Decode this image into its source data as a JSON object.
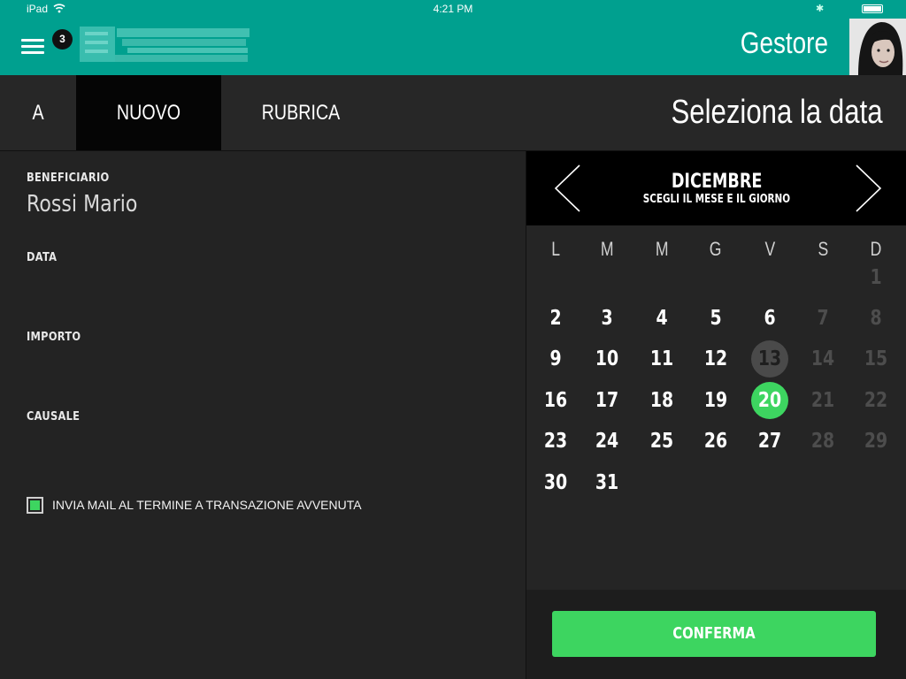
{
  "status_bar": {
    "carrier": "iPad",
    "time": "4:21 PM"
  },
  "header": {
    "menu_badge": "3",
    "manager_label": "Gestore",
    "accent_color": "#00a08f",
    "icons": [
      "menu-icon",
      "wifi-icon",
      "bluetooth-icon",
      "battery-icon"
    ]
  },
  "tabs": {
    "items": [
      {
        "label": "A"
      },
      {
        "label": "NUOVO",
        "active": true
      },
      {
        "label": "RUBRICA"
      }
    ],
    "section_title": "Seleziona la data"
  },
  "form": {
    "beneficiary_label": "BENEFICIARIO",
    "beneficiary_value": "Rossi Mario",
    "date_label": "DATA",
    "amount_label": "IMPORTO",
    "reason_label": "CAUSALE",
    "send_mail_label": "INVIA MAIL AL TERMINE A TRANSAZIONE AVVENUTA",
    "send_mail_checked": true,
    "check_color": "#3dd560"
  },
  "calendar": {
    "month": "DICEMBRE",
    "subtitle": "SCEGLI IL MESE E IL GIORNO",
    "weekdays": [
      "L",
      "M",
      "M",
      "G",
      "V",
      "S",
      "D"
    ],
    "weeks": [
      [
        "",
        "",
        "",
        "",
        "",
        "",
        "1"
      ],
      [
        "2",
        "3",
        "4",
        "5",
        "6",
        "7",
        "8"
      ],
      [
        "9",
        "10",
        "11",
        "12",
        "13",
        "14",
        "15"
      ],
      [
        "16",
        "17",
        "18",
        "19",
        "20",
        "21",
        "22"
      ],
      [
        "23",
        "24",
        "25",
        "26",
        "27",
        "28",
        "29"
      ],
      [
        "30",
        "31",
        "",
        "",
        "",
        "",
        ""
      ]
    ],
    "today": "13",
    "selected": "20",
    "selected_color": "#3dd560",
    "confirm_label": "CONFERMA"
  }
}
